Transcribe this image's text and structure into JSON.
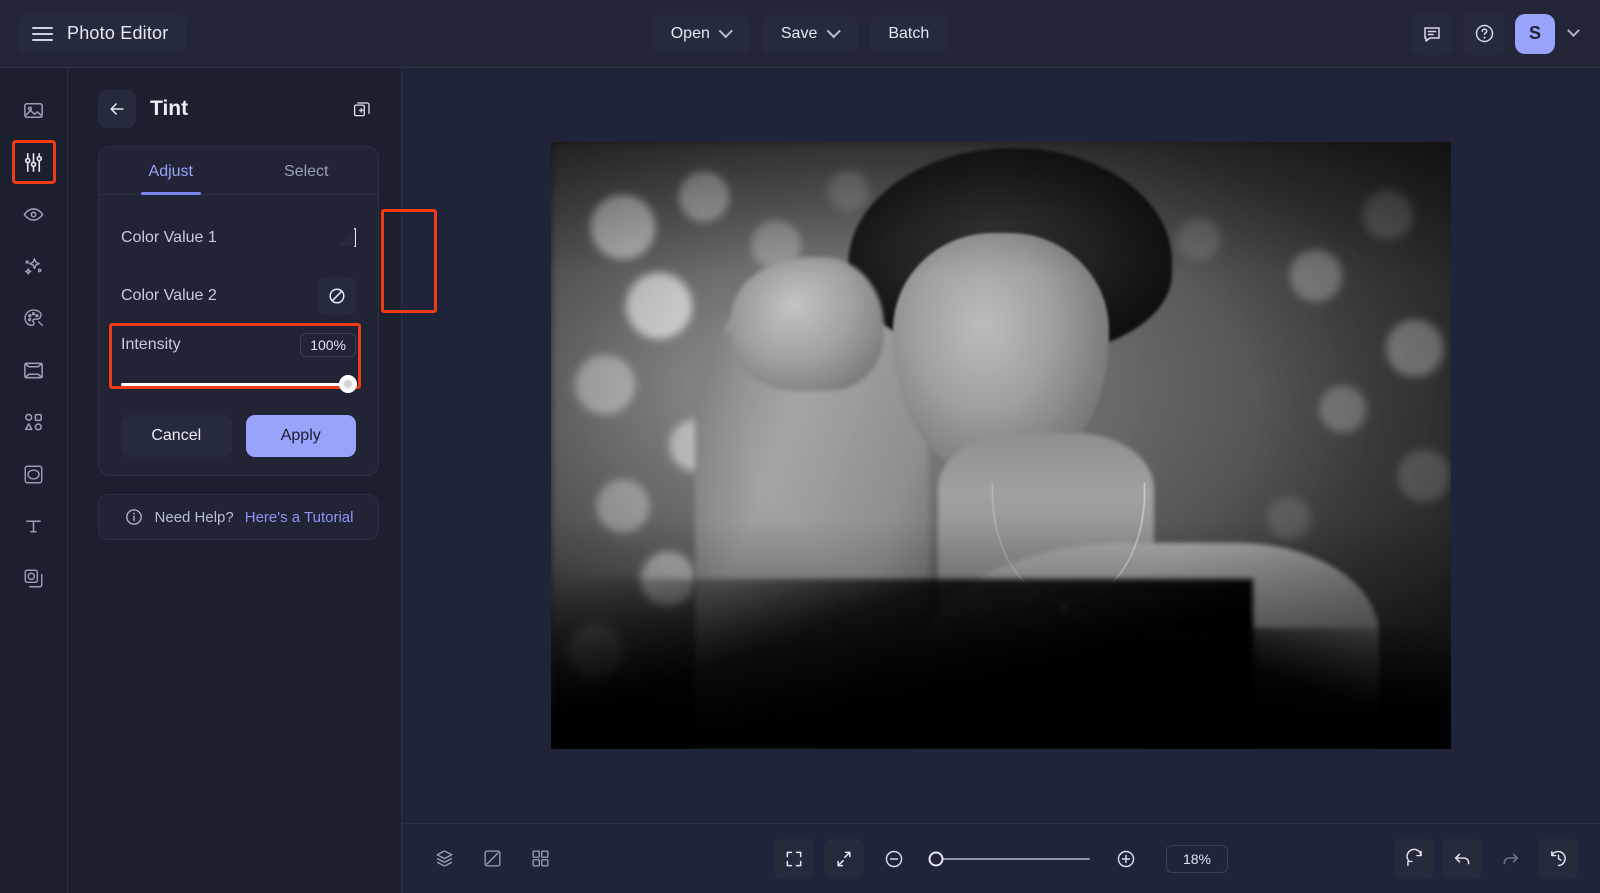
{
  "header": {
    "menu_icon": "hamburger-icon",
    "app_title": "Photo Editor",
    "buttons": [
      {
        "label": "Open",
        "has_chevron": true
      },
      {
        "label": "Save",
        "has_chevron": true
      },
      {
        "label": "Batch",
        "has_chevron": false
      }
    ],
    "right_icons": [
      "feedback-icon",
      "help-icon"
    ],
    "avatar_initial": "S",
    "accent_color": "#9aa3fb"
  },
  "sidebar": {
    "items": [
      {
        "name": "image",
        "icon": "image-icon",
        "active": false
      },
      {
        "name": "adjust",
        "icon": "sliders-icon",
        "active": true
      },
      {
        "name": "retouch",
        "icon": "eye-icon",
        "active": false
      },
      {
        "name": "effects",
        "icon": "sparkles-icon",
        "active": false
      },
      {
        "name": "color",
        "icon": "palette-icon",
        "active": false
      },
      {
        "name": "frame",
        "icon": "frame-icon",
        "active": false
      },
      {
        "name": "shapes",
        "icon": "shapes-icon",
        "active": false
      },
      {
        "name": "selection",
        "icon": "lasso-icon",
        "active": false
      },
      {
        "name": "text",
        "icon": "text-icon",
        "active": false
      },
      {
        "name": "layers",
        "icon": "layers-icon",
        "active": false
      }
    ]
  },
  "panel": {
    "back_icon": "arrow-left-icon",
    "title": "Tint",
    "header_action_icon": "duplicate-add-icon",
    "tabs": [
      {
        "label": "Adjust",
        "active": true
      },
      {
        "label": "Select",
        "active": false
      }
    ],
    "color_value_1": {
      "label": "Color Value 1",
      "swatch_color": "#ffffff",
      "type": "color-swatch"
    },
    "color_value_2": {
      "label": "Color Value 2",
      "swatch_color": "none",
      "type": "no-color-icon"
    },
    "intensity": {
      "label": "Intensity",
      "value": "100%",
      "percent": 100
    },
    "cancel_label": "Cancel",
    "apply_label": "Apply",
    "help": {
      "icon": "info-icon",
      "text": "Need Help?",
      "link": "Here's a Tutorial"
    }
  },
  "annotations": {
    "color_swatches_highlight": true,
    "intensity_highlight": true,
    "sidebar_adjust_highlight": true,
    "color": "#f03c16"
  },
  "bottombar": {
    "left_icons": [
      "layers-stack-icon",
      "compare-split-icon",
      "grid-icon"
    ],
    "center_icons": [
      "fit-screen-icon",
      "shrink-icon",
      "zoom-out-icon",
      "zoom-in-icon"
    ],
    "zoom_value": "18%",
    "zoom_percent": 18,
    "right_icons": [
      "reset-icon",
      "undo-icon",
      "redo-icon",
      "history-icon"
    ],
    "redo_disabled": true
  },
  "canvas": {
    "image_description": "black-and-white portrait of a woman resting her head on her hand with bokeh foliage background"
  }
}
